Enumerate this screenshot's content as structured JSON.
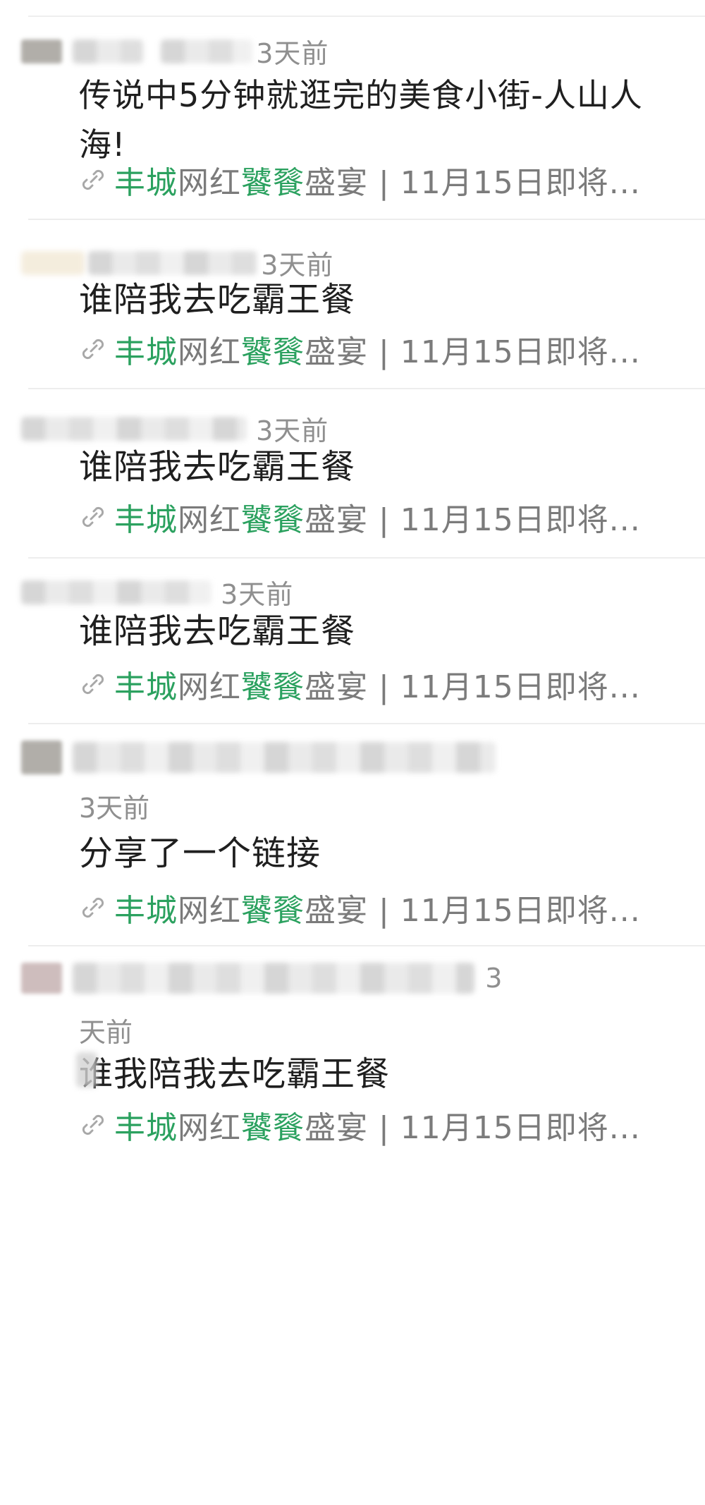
{
  "link": {
    "part1": "丰城",
    "part2": "网红",
    "part3": "饕餮",
    "part4": "盛宴 | 11月15日即将..."
  },
  "messages": [
    {
      "time": "3天前",
      "text": "传说中5分钟就逛完的美食小街-人山人海!"
    },
    {
      "time": "3天前",
      "text": "谁陪我去吃霸王餐"
    },
    {
      "time": "3天前",
      "text": "谁陪我去吃霸王餐"
    },
    {
      "time": "3天前",
      "text": "谁陪我去吃霸王餐"
    },
    {
      "time": "3天前",
      "text": "分享了一个链接"
    },
    {
      "time_part1": "3",
      "time_part2": "天前",
      "text": "谁我陪我去吃霸王餐"
    }
  ]
}
